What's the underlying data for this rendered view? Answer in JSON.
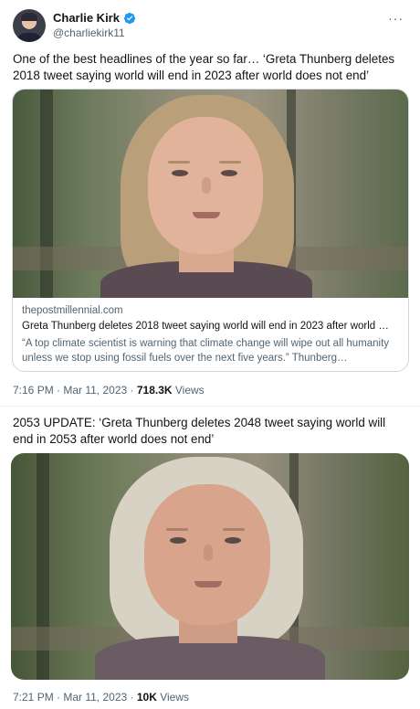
{
  "tweet1": {
    "author": {
      "name": "Charlie Kirk",
      "handle": "@charliekirk11",
      "verified_color": "#1d9bf0"
    },
    "more_icon": "more-horizontal-icon",
    "text": "One of the best headlines of the year so far… ‘Greta Thunberg deletes 2018 tweet saying world will end in 2023 after world does not end’",
    "card": {
      "domain": "thepostmillennial.com",
      "title": "Greta Thunberg deletes 2018 tweet saying world will end in 2023 after world …",
      "description": "“A top climate scientist is warning that climate change will wipe out all humanity unless we stop using fossil fuels over the next five years.” Thunberg…"
    },
    "meta": {
      "timestamp": "7:16 PM · Mar 11, 2023 · ",
      "views_count": "718.3K",
      "views_label": " Views"
    }
  },
  "tweet2": {
    "text": "2053 UPDATE: ‘Greta Thunberg deletes 2048 tweet saying world will end in 2053 after world does not end’",
    "meta": {
      "timestamp": "7:21 PM · Mar 11, 2023 · ",
      "views_count": "10K",
      "views_label": " Views"
    }
  }
}
